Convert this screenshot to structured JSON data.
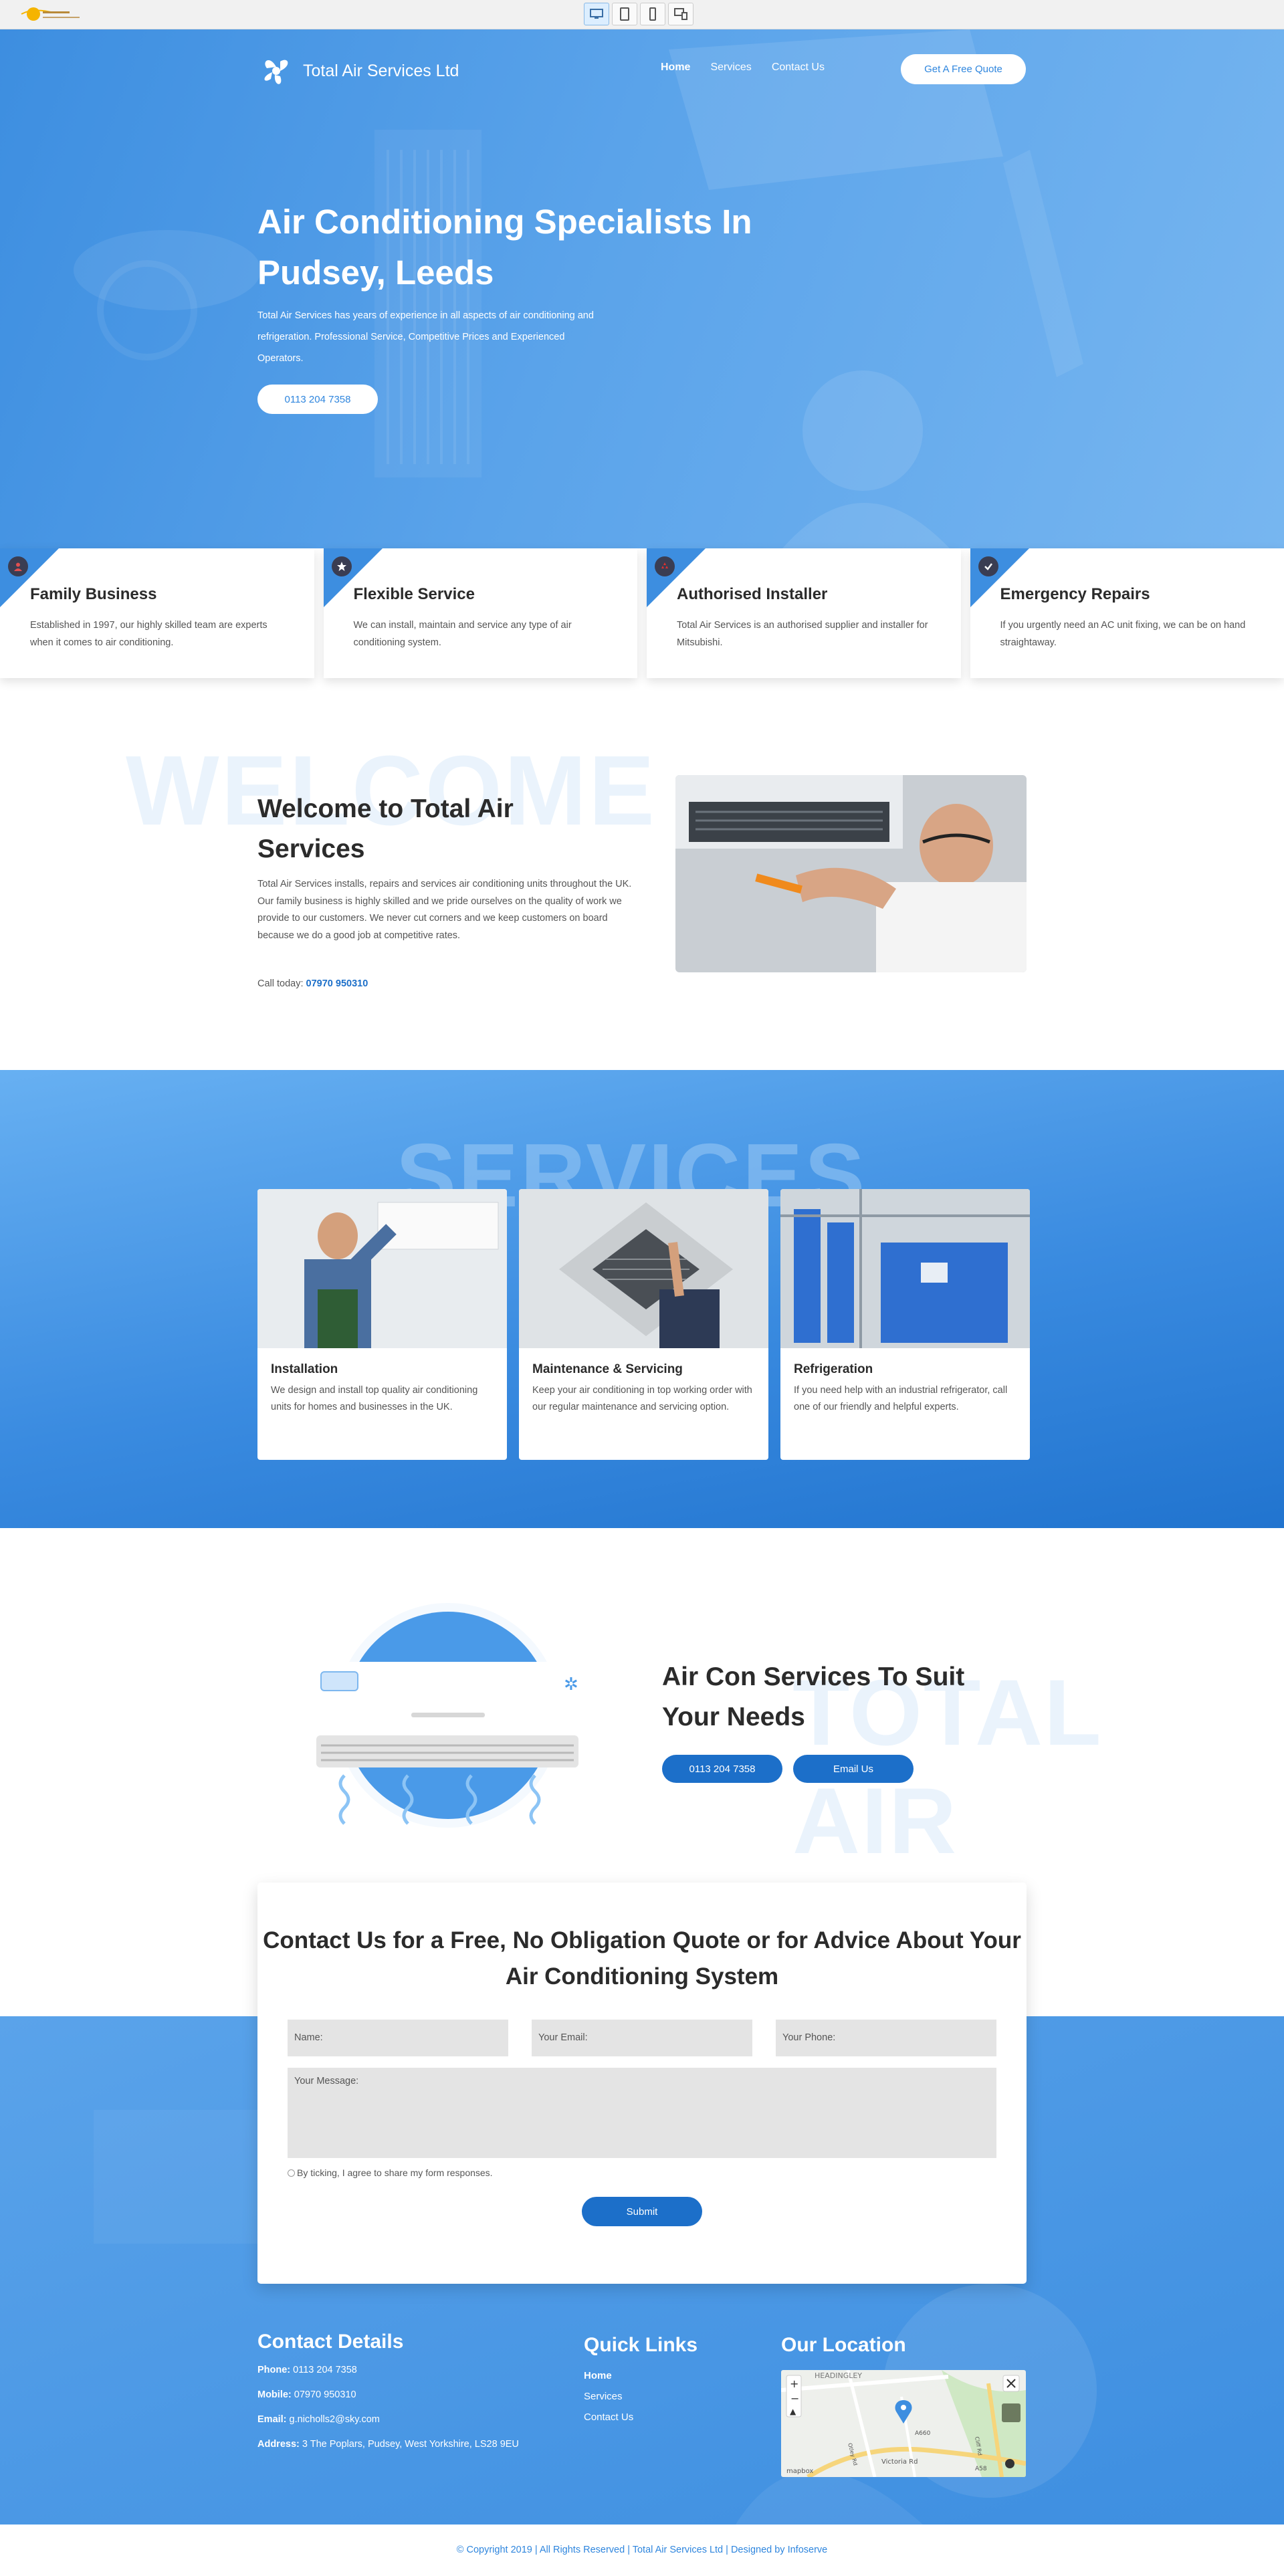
{
  "preview_bar": {
    "devices": [
      "desktop",
      "tablet",
      "phone",
      "responsive"
    ]
  },
  "header": {
    "brand": "Total Air Services Ltd",
    "nav": [
      "Home",
      "Services",
      "Contact Us"
    ],
    "quote_button": "Get A Free Quote"
  },
  "hero": {
    "title": "Air Conditioning Specialists In Pudsey, Leeds",
    "text": "Total Air Services has years of experience in all aspects of air conditioning and refrigeration. Professional Service, Competitive Prices and Experienced Operators.",
    "phone_button": "0113 204 7358"
  },
  "features": [
    {
      "title": "Family Business",
      "text": "Established in 1997, our highly skilled team are experts when it comes to air conditioning.",
      "icon": "user-icon"
    },
    {
      "title": "Flexible Service",
      "text": "We can install, maintain and service any type of air conditioning system.",
      "icon": "star-icon"
    },
    {
      "title": "Authorised Installer",
      "text": "Total Air Services is an authorised supplier and installer for Mitsubishi.",
      "icon": "mitsubishi-icon"
    },
    {
      "title": "Emergency Repairs",
      "text": "If you urgently need an AC unit fixing, we can be on hand straightaway.",
      "icon": "check-icon"
    }
  ],
  "welcome": {
    "bg_word": "WELCOME",
    "title": "Welcome to Total Air Services",
    "text": "Total Air Services installs, repairs and services air conditioning units throughout the UK. Our family business is highly skilled and we pride ourselves on the quality of work we provide to our customers. We never cut corners and we keep customers on board because we do a good job at competitive rates.",
    "call_label": "Call today: ",
    "call_number": "07970 950310"
  },
  "services": {
    "bg_word": "SERVICES",
    "cards": [
      {
        "title": "Installation",
        "text": "We design and install top quality air conditioning units for homes and businesses in the UK."
      },
      {
        "title": "Maintenance & Servicing",
        "text": "Keep your air conditioning in top working order with our regular maintenance and servicing option."
      },
      {
        "title": "Refrigeration",
        "text": "If you need help with an industrial refrigerator, call one of our friendly and helpful experts."
      }
    ]
  },
  "aircon": {
    "bg_word": "TOTAL AIR",
    "title": "Air Con Services To Suit Your Needs",
    "phone_button": "0113 204 7358",
    "email_button": "Email Us"
  },
  "contact_form": {
    "title": "Contact Us for a Free, No Obligation Quote or for Advice About Your Air Conditioning System",
    "name_placeholder": "Name:",
    "email_placeholder": "Your Email:",
    "phone_placeholder": "Your Phone:",
    "message_placeholder": "Your Message:",
    "consent": "By ticking, I agree to share my form responses.",
    "submit": "Submit"
  },
  "footer": {
    "contact_title": "Contact Details",
    "phone_label": "Phone:",
    "phone": "0113 204 7358",
    "mobile_label": "Mobile:",
    "mobile": "07970 950310",
    "email_label": "Email:",
    "email": "g.nicholls2@sky.com",
    "address_label": "Address:",
    "address": "3 The Poplars, Pudsey, West Yorkshire, LS28 9EU",
    "links_title": "Quick Links",
    "links": [
      "Home",
      "Services",
      "Contact Us"
    ],
    "location_title": "Our Location",
    "map_labels": {
      "area": "HEADINGLEY",
      "road": "Victoria Rd",
      "a660": "A660",
      "a58": "A58",
      "cliff": "Cliff Rd",
      "otley": "Otley Rd",
      "mapbox": "mapbox"
    },
    "copyright": "© Copyright 2019 | All Rights Reserved | Total Air Services Ltd | Designed by Infoserve"
  },
  "colors": {
    "primary": "#3d8ee0",
    "dark_blue": "#1c6fc9",
    "text": "#2b2b2b"
  }
}
